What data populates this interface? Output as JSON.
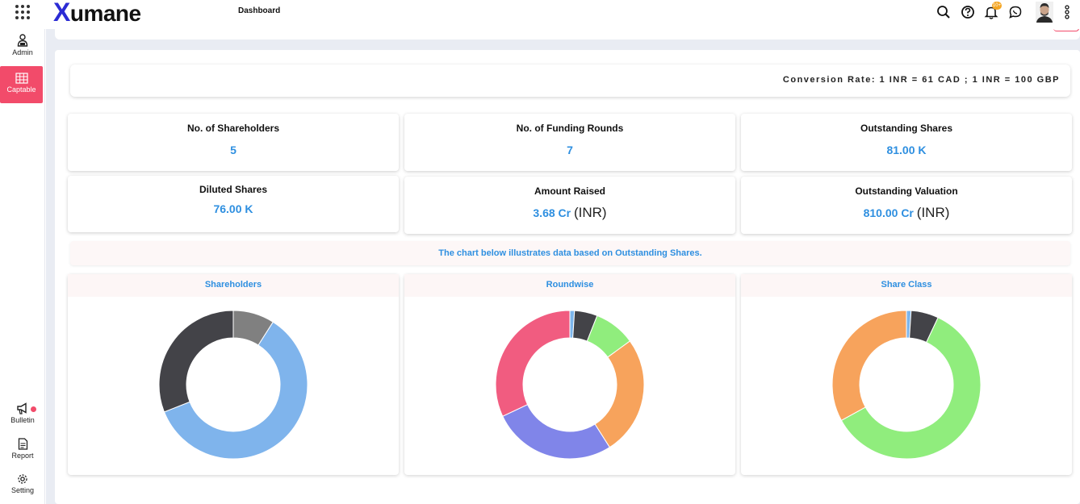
{
  "app": {
    "logo_mark": "X",
    "logo_text": "umane",
    "page_title": "Dashboard"
  },
  "topbar": {
    "icons": [
      "search-icon",
      "help-icon",
      "bell-icon",
      "chat-icon",
      "avatar",
      "more-vertical-icon"
    ],
    "notification_badge": "10+"
  },
  "sidebar": {
    "top_items": [
      {
        "label": "Admin",
        "icon": "admin-icon"
      },
      {
        "label": "Captable",
        "icon": "table-icon",
        "active": true
      }
    ],
    "bottom_items": [
      {
        "label": "Bulletin",
        "icon": "megaphone-icon",
        "has_dot": true
      },
      {
        "label": "Report",
        "icon": "report-icon"
      },
      {
        "label": "Setting",
        "icon": "gear-icon"
      }
    ]
  },
  "conversion_rate": "Conversion Rate: 1 INR = 61 CAD ; 1 INR = 100 GBP",
  "stats": [
    {
      "label": "No. of Shareholders",
      "value": "5"
    },
    {
      "label": "No. of Funding Rounds",
      "value": "7"
    },
    {
      "label": "Outstanding Shares",
      "value": "81.00 K"
    },
    {
      "label": "Diluted Shares",
      "value": "76.00 K"
    },
    {
      "label": "Amount Raised",
      "value": "3.68 Cr",
      "unit": "(INR)"
    },
    {
      "label": "Outstanding Valuation",
      "value": "810.00 Cr",
      "unit": "(INR)"
    }
  ],
  "chart_note": "The chart below illustrates data based on Outstanding Shares.",
  "colors": {
    "accent": "#f24b6a",
    "value_blue": "#2e8fe0"
  },
  "chart_data": [
    {
      "type": "pie",
      "title": "Shareholders",
      "values": [
        9,
        60,
        31
      ],
      "colors": [
        "#808080",
        "#7fb4ec",
        "#434348"
      ]
    },
    {
      "type": "pie",
      "title": "Roundwise",
      "values": [
        1,
        5,
        9,
        26,
        27,
        32
      ],
      "colors": [
        "#7cb5ec",
        "#434348",
        "#90ed7d",
        "#f7a35c",
        "#8085e9",
        "#f15c80"
      ]
    },
    {
      "type": "pie",
      "title": "Share Class",
      "values": [
        1,
        6,
        60,
        33
      ],
      "colors": [
        "#7cb5ec",
        "#434348",
        "#90ed7d",
        "#f7a35c"
      ]
    }
  ]
}
